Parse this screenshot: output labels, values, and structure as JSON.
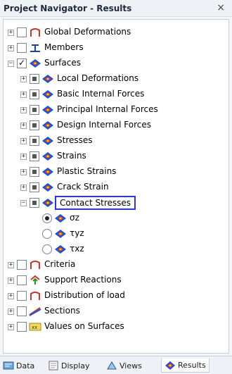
{
  "window": {
    "title": "Project Navigator - Results",
    "close_label": "×"
  },
  "tree": {
    "global_deformations": "Global Deformations",
    "members": "Members",
    "surfaces": "Surfaces",
    "local_deformations": "Local Deformations",
    "basic_internal_forces": "Basic Internal Forces",
    "principal_internal_forces": "Principal Internal Forces",
    "design_internal_forces": "Design Internal Forces",
    "stresses": "Stresses",
    "strains": "Strains",
    "plastic_strains": "Plastic Strains",
    "crack_strain": "Crack Strain",
    "contact_stresses": "Contact Stresses",
    "sigma_z": "σz",
    "tau_yz": "τyz",
    "tau_xz": "τxz",
    "criteria": "Criteria",
    "support_reactions": "Support Reactions",
    "distribution_of_load": "Distribution of load",
    "sections": "Sections",
    "values_on_surfaces": "Values on Surfaces"
  },
  "tabs": {
    "data": "Data",
    "display": "Display",
    "views": "Views",
    "results": "Results"
  },
  "colors": {
    "selection_border": "#2a39d6",
    "accent_blue": "#1e4fd0"
  }
}
